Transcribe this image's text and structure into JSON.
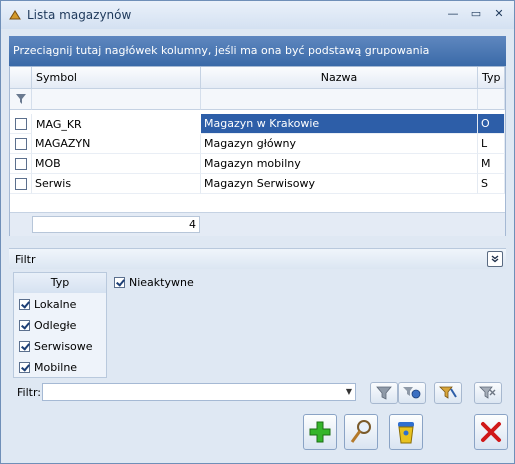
{
  "window": {
    "title": "Lista magazynów",
    "minimize_label": "—",
    "maximize_label": "▭",
    "close_label": "✕"
  },
  "grid": {
    "group_hint": "Przeciągnij tutaj nagłówek kolumny, jeśli ma ona być podstawą grupowania",
    "columns": [
      "Symbol",
      "Nazwa",
      "Typ"
    ],
    "rows": [
      {
        "symbol": "MAG_KR",
        "nazwa": "Magazyn w Krakowie",
        "typ": "O",
        "selected": true
      },
      {
        "symbol": "MAGAZYN",
        "nazwa": "Magazyn główny",
        "typ": "L",
        "selected": false
      },
      {
        "symbol": "MOB",
        "nazwa": "Magazyn mobilny",
        "typ": "M",
        "selected": false
      },
      {
        "symbol": "Serwis",
        "nazwa": "Magazyn Serwisowy",
        "typ": "S",
        "selected": false
      }
    ],
    "count": "4",
    "selection_color": "#2d5ea8"
  },
  "filter": {
    "header": "Filtr",
    "typ_header": "Typ",
    "types": [
      {
        "label": "Lokalne",
        "checked": true
      },
      {
        "label": "Odległe",
        "checked": true
      },
      {
        "label": "Serwisowe",
        "checked": true
      },
      {
        "label": "Mobilne",
        "checked": true
      }
    ],
    "nieaktywne_label": "Nieaktywne",
    "nieaktywne_checked": true,
    "filtr_label": "Filtr:",
    "filtr_value": ""
  },
  "icons": {
    "filter_buttons": [
      "funnel-icon",
      "funnel-run-icon",
      "funnel-edit-icon",
      "funnel-clear-icon"
    ],
    "action_buttons": [
      "add-icon",
      "preview-icon",
      "delete-icon",
      "close-icon"
    ]
  }
}
